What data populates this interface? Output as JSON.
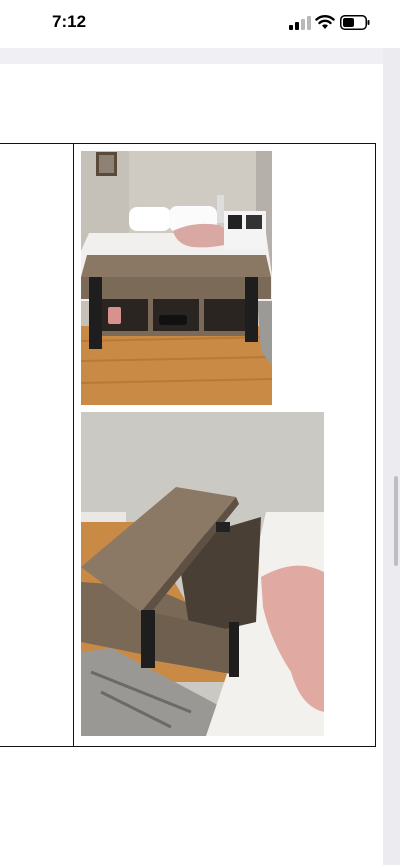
{
  "status_bar": {
    "time": "7:12",
    "icons": [
      "cellular-signal-icon",
      "wifi-icon",
      "battery-icon"
    ]
  },
  "document": {
    "table": {
      "rows": [
        {
          "left_cell": "",
          "images": [
            "coffee-table-closed-photo",
            "coffee-table-lifted-photo"
          ]
        }
      ]
    }
  },
  "colors": {
    "wall": "#cfcac2",
    "wood_floor": "#c98a45",
    "table_wood": "#7c6a58",
    "table_legs": "#1e1e1e"
  }
}
